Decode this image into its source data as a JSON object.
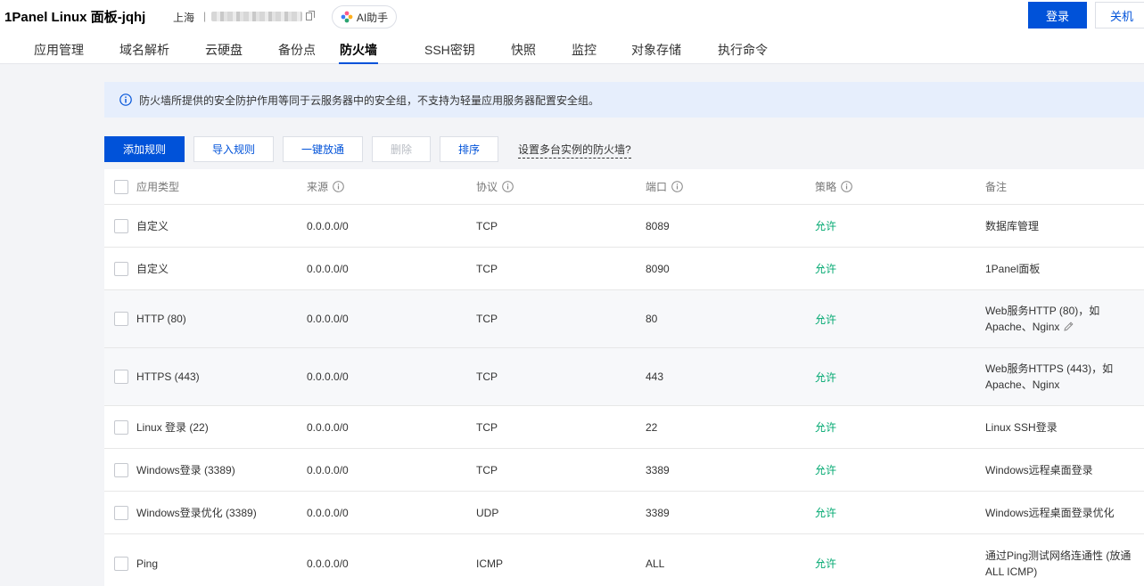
{
  "header": {
    "title": "1Panel Linux 面板-jqhj",
    "region": "上海",
    "separator": "|",
    "ai_label": "AI助手",
    "login_label": "登录",
    "shutdown_label": "关机"
  },
  "tabs": [
    {
      "label": "应用管理"
    },
    {
      "label": "域名解析"
    },
    {
      "label": "云硬盘"
    },
    {
      "label": "备份点"
    },
    {
      "label": "防火墙",
      "active": true
    },
    {
      "label": "SSH密钥"
    },
    {
      "label": "快照"
    },
    {
      "label": "监控"
    },
    {
      "label": "对象存储"
    },
    {
      "label": "执行命令"
    }
  ],
  "notice": {
    "text": "防火墙所提供的安全防护作用等同于云服务器中的安全组，不支持为轻量应用服务器配置安全组。"
  },
  "toolbar": {
    "add_label": "添加规则",
    "import_label": "导入规则",
    "open_all_label": "一键放通",
    "delete_label": "删除",
    "sort_label": "排序",
    "multi_link": "设置多台实例的防火墙?"
  },
  "table": {
    "columns": {
      "type": "应用类型",
      "source": "来源",
      "protocol": "协议",
      "port": "端口",
      "policy": "策略",
      "note": "备注"
    },
    "rows": [
      {
        "type": "自定义",
        "source": "0.0.0.0/0",
        "protocol": "TCP",
        "port": "8089",
        "policy": "允许",
        "note": "数据库管理"
      },
      {
        "type": "自定义",
        "source": "0.0.0.0/0",
        "protocol": "TCP",
        "port": "8090",
        "policy": "允许",
        "note": "1Panel面板"
      },
      {
        "type": "HTTP (80)",
        "source": "0.0.0.0/0",
        "protocol": "TCP",
        "port": "80",
        "policy": "允许",
        "note": "Web服务HTTP (80)，如Apache、Nginx"
      },
      {
        "type": "HTTPS (443)",
        "source": "0.0.0.0/0",
        "protocol": "TCP",
        "port": "443",
        "policy": "允许",
        "note": "Web服务HTTPS (443)，如Apache、Nginx"
      },
      {
        "type": "Linux 登录 (22)",
        "source": "0.0.0.0/0",
        "protocol": "TCP",
        "port": "22",
        "policy": "允许",
        "note": "Linux SSH登录"
      },
      {
        "type": "Windows登录 (3389)",
        "source": "0.0.0.0/0",
        "protocol": "TCP",
        "port": "3389",
        "policy": "允许",
        "note": "Windows远程桌面登录"
      },
      {
        "type": "Windows登录优化 (3389)",
        "source": "0.0.0.0/0",
        "protocol": "UDP",
        "port": "3389",
        "policy": "允许",
        "note": "Windows远程桌面登录优化"
      },
      {
        "type": "Ping",
        "source": "0.0.0.0/0",
        "protocol": "ICMP",
        "port": "ALL",
        "policy": "允许",
        "note": "通过Ping测试网络连通性 (放通ALL ICMP)"
      }
    ]
  },
  "colors": {
    "primary": "#0052d9",
    "allow": "#00a870",
    "notice_bg": "#e6eefc"
  }
}
